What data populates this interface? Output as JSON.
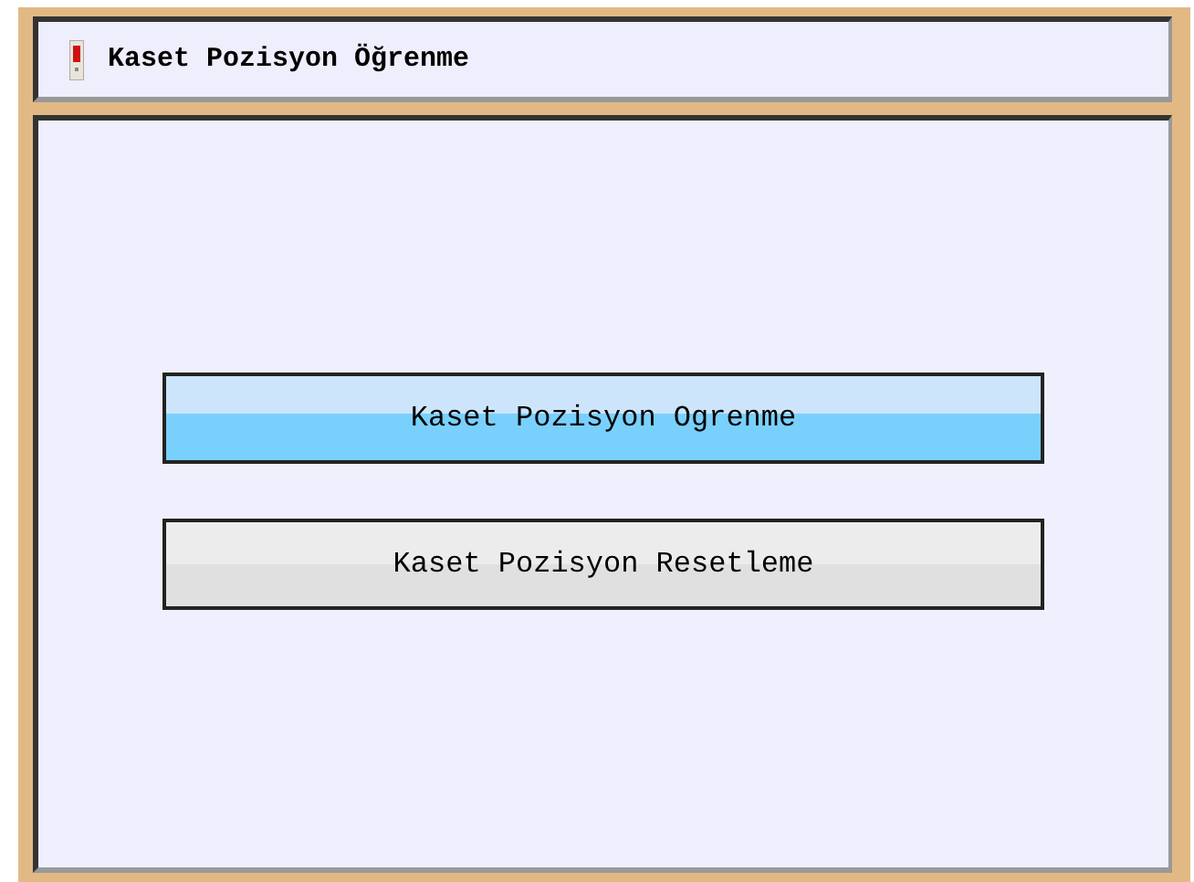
{
  "window": {
    "title": "Kaset Pozisyon Öğrenme"
  },
  "buttons": [
    {
      "label": "Kaset Pozisyon Ogrenme",
      "selected": true
    },
    {
      "label": "Kaset Pozisyon Resetleme",
      "selected": false
    }
  ]
}
